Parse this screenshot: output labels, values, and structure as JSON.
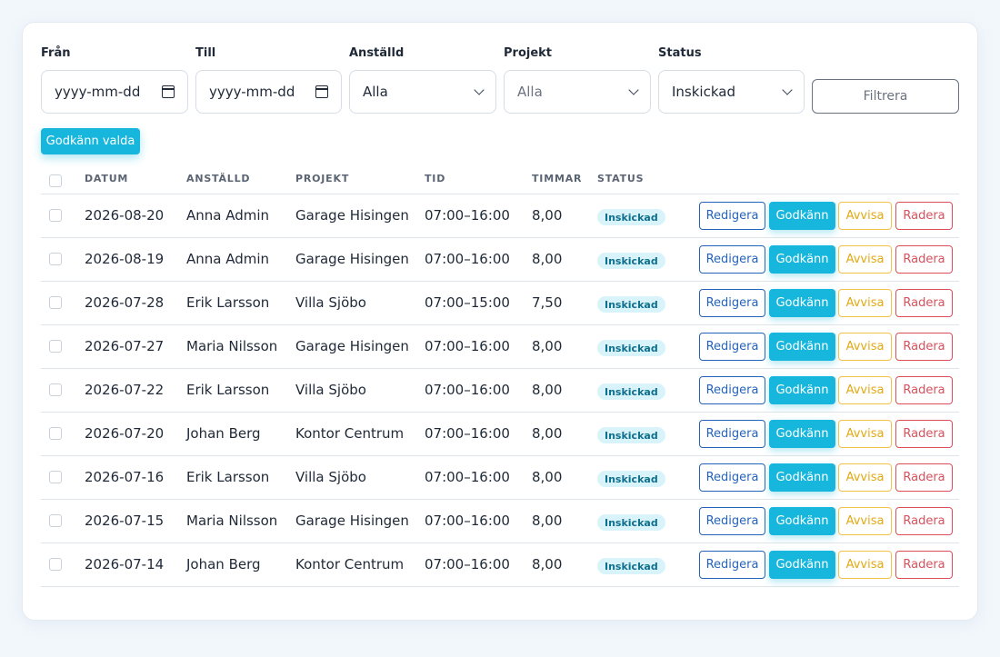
{
  "filters": {
    "from": {
      "label": "Från",
      "placeholder": "yyyy-mm-dd"
    },
    "to": {
      "label": "Till",
      "placeholder": "yyyy-mm-dd"
    },
    "employee": {
      "label": "Anställd",
      "value": "Alla"
    },
    "project": {
      "label": "Projekt",
      "value": "Alla"
    },
    "status": {
      "label": "Status",
      "value": "Inskickad"
    },
    "filter_button": "Filtrera"
  },
  "bulk_approve_button": "Godkänn valda",
  "table": {
    "headers": {
      "date": "DATUM",
      "employee": "ANSTÄLLD",
      "project": "PROJEKT",
      "time": "TID",
      "hours": "TIMMAR",
      "status": "STATUS"
    },
    "actions": {
      "edit": "Redigera",
      "approve": "Godkänn",
      "reject": "Avvisa",
      "delete": "Radera"
    },
    "rows": [
      {
        "date": "2026-08-20",
        "employee": "Anna Admin",
        "project": "Garage Hisingen",
        "time": "07:00–16:00",
        "hours": "8,00",
        "status": "Inskickad"
      },
      {
        "date": "2026-08-19",
        "employee": "Anna Admin",
        "project": "Garage Hisingen",
        "time": "07:00–16:00",
        "hours": "8,00",
        "status": "Inskickad"
      },
      {
        "date": "2026-07-28",
        "employee": "Erik Larsson",
        "project": "Villa Sjöbo",
        "time": "07:00–15:00",
        "hours": "7,50",
        "status": "Inskickad"
      },
      {
        "date": "2026-07-27",
        "employee": "Maria Nilsson",
        "project": "Garage Hisingen",
        "time": "07:00–16:00",
        "hours": "8,00",
        "status": "Inskickad"
      },
      {
        "date": "2026-07-22",
        "employee": "Erik Larsson",
        "project": "Villa Sjöbo",
        "time": "07:00–16:00",
        "hours": "8,00",
        "status": "Inskickad"
      },
      {
        "date": "2026-07-20",
        "employee": "Johan Berg",
        "project": "Kontor Centrum",
        "time": "07:00–16:00",
        "hours": "8,00",
        "status": "Inskickad"
      },
      {
        "date": "2026-07-16",
        "employee": "Erik Larsson",
        "project": "Villa Sjöbo",
        "time": "07:00–16:00",
        "hours": "8,00",
        "status": "Inskickad"
      },
      {
        "date": "2026-07-15",
        "employee": "Maria Nilsson",
        "project": "Garage Hisingen",
        "time": "07:00–16:00",
        "hours": "8,00",
        "status": "Inskickad"
      },
      {
        "date": "2026-07-14",
        "employee": "Johan Berg",
        "project": "Kontor Centrum",
        "time": "07:00–16:00",
        "hours": "8,00",
        "status": "Inskickad"
      }
    ]
  },
  "colors": {
    "primary": "#17b6dc",
    "edit": "#2563b8",
    "reject": "#e3a913",
    "delete": "#d9505c"
  }
}
